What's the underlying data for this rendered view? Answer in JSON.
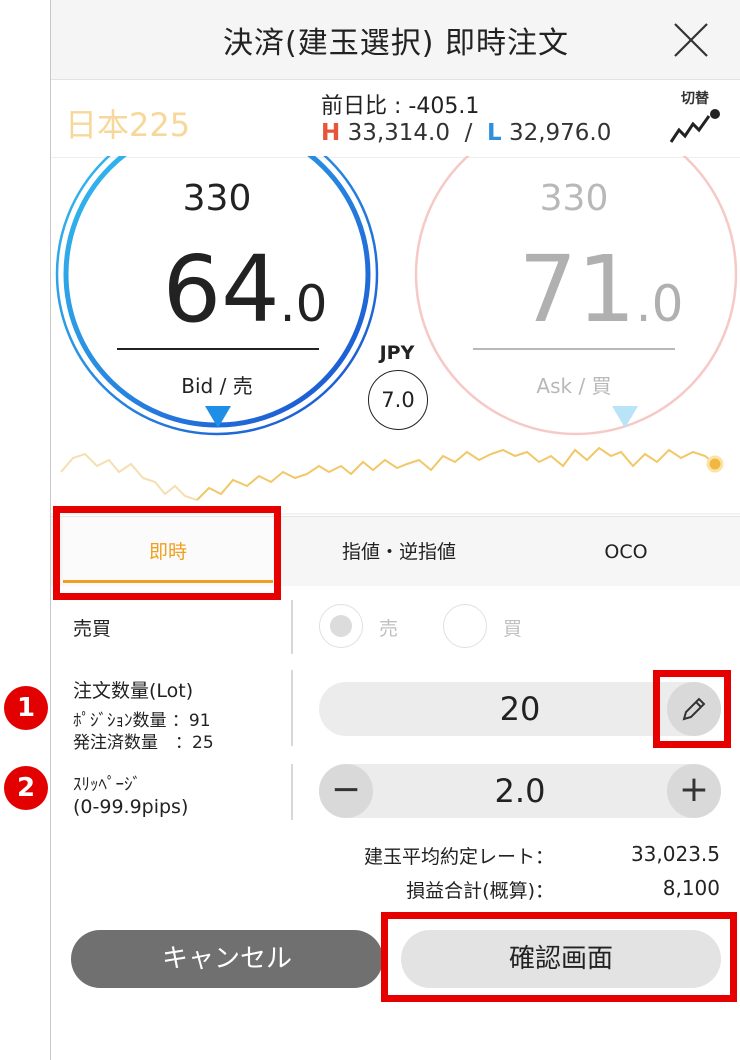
{
  "header": {
    "title": "決済(建玉選択) 即時注文",
    "close_icon": "close-icon"
  },
  "instrument": {
    "name": "日本225",
    "day_change": "前日比 : -405.1",
    "high_label": "H",
    "high_value": "33,314.0",
    "separator": "/",
    "low_label": "L",
    "low_value": "32,976.0",
    "switch_label": "切替",
    "switch_icon": "chart-trend-icon"
  },
  "bid": {
    "top": "330",
    "main": "64",
    "decimal": ".0",
    "label": "Bid / 売"
  },
  "ask": {
    "top": "330",
    "main": "71",
    "decimal": ".0",
    "label": "Ask / 買"
  },
  "currency": "JPY",
  "spread": "7.0",
  "tabs": [
    {
      "label": "即時",
      "active": true
    },
    {
      "label": "指値・逆指値",
      "active": false
    },
    {
      "label": "OCO",
      "active": false
    }
  ],
  "form": {
    "side_label": "売買",
    "side_options": [
      {
        "label": "売",
        "selected": true
      },
      {
        "label": "買",
        "selected": false
      }
    ],
    "qty_label": "注文数量(Lot)",
    "position_qty": "ﾎﾟｼﾞｼｮﾝ数量 ：91",
    "ordered_qty": "発注済数量　：25",
    "qty_value": "20",
    "slippage_label": "ｽﾘｯﾍﾟｰｼﾞ",
    "slippage_range": "(0-99.9pips)",
    "slippage_value": "2.0",
    "minus": "−",
    "plus": "+"
  },
  "summary": {
    "avg_rate_label": "建玉平均約定レート：",
    "avg_rate_value": "33,023.5",
    "pnl_label": "損益合計(概算)：",
    "pnl_value": "8,100"
  },
  "buttons": {
    "cancel": "キャンセル",
    "confirm": "確認画面"
  },
  "annotations": {
    "badge1": "1",
    "badge2": "2"
  },
  "colors": {
    "bid_blue": "#1a73d9",
    "ask_pink": "#f6c9c6",
    "accent_orange": "#f0a020",
    "annotation_red": "#e60000"
  }
}
